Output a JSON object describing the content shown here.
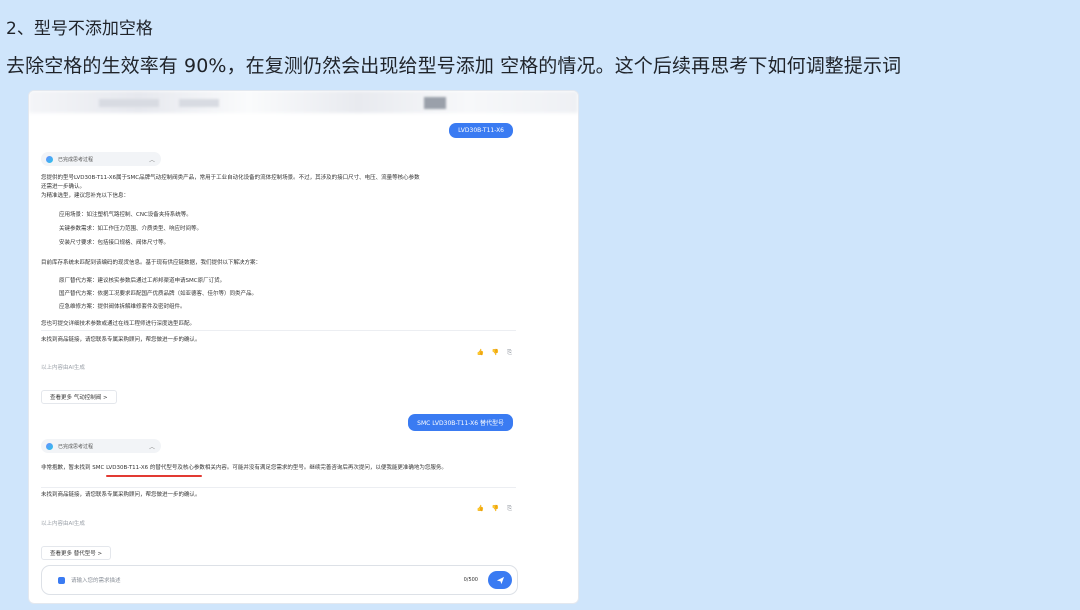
{
  "note": {
    "heading": "2、型号不添加空格",
    "body": "去除空格的生效率有 90%，在复测仍然会出现给型号添加 空格的情况。这个后续再思考下如何调整提示词"
  },
  "chat": {
    "messages": [
      {
        "user": "LVD30B-T11-X6",
        "think_label": "已完成思考过程",
        "lines": [
          "您提供的型号LVD30B-T11-X6属于SMC品牌气动控制阀类产品，常用于工业自动化设备的流体控制场景。不过，其涉及的接口尺寸、电压、流量等核心参数",
          "还需进一步确认。",
          "为精准选型，建议您补充以下信息："
        ],
        "bullets1": [
          "应用场景：如注塑机气路控制、CNC设备夹持系统等。",
          "关键参数需求：如工作压力范围、介质类型、响应时间等。",
          "安装尺寸要求：包括接口规格、阀体尺寸等。"
        ],
        "mid": "目前库存系统未匹配到该编码的现货信息。基于现有供应链数据，我们提供以下解决方案：",
        "bullets2": [
          "原厂替代方案：建议核实参数后通过工邦邦渠道申请SMC原厂订货。",
          "国产替代方案：依据工况要求匹配国产优质品牌（如亚德客、佳尔等）同类产品。",
          "应急维修方案：提供阀体拆解维修套件及密封组件。"
        ],
        "closing": "您也可提交详细技术参数或通过在线工程师进行深度选型匹配。",
        "contact": "未找到商品链接，请您联系专属采购顾问，帮您做进一步的确认。",
        "ai_note": "以上内容由AI生成",
        "more_chip": "查看更多 气动控制阀 >"
      },
      {
        "user": "SMC LVD30B-T11-X6 替代型号",
        "think_label": "已完成思考过程",
        "answer": "非常抱歉，暂未找到 SMC LVD30B-T11-X6 的替代型号及核心参数相关内容。可能并没有满足您需求的型号。继续完善咨询后再次提问，以便我能更准确地为您服务。",
        "contact": "未找到商品链接，请您联系专属采购顾问，帮您做进一步的确认。",
        "ai_note": "以上内容由AI生成",
        "more_chip": "查看更多 替代型号 >"
      }
    ],
    "feedback_icons": "👍 👎 ⎘",
    "input": {
      "placeholder": "请输入您的需求描述",
      "counter": "0/500"
    }
  }
}
